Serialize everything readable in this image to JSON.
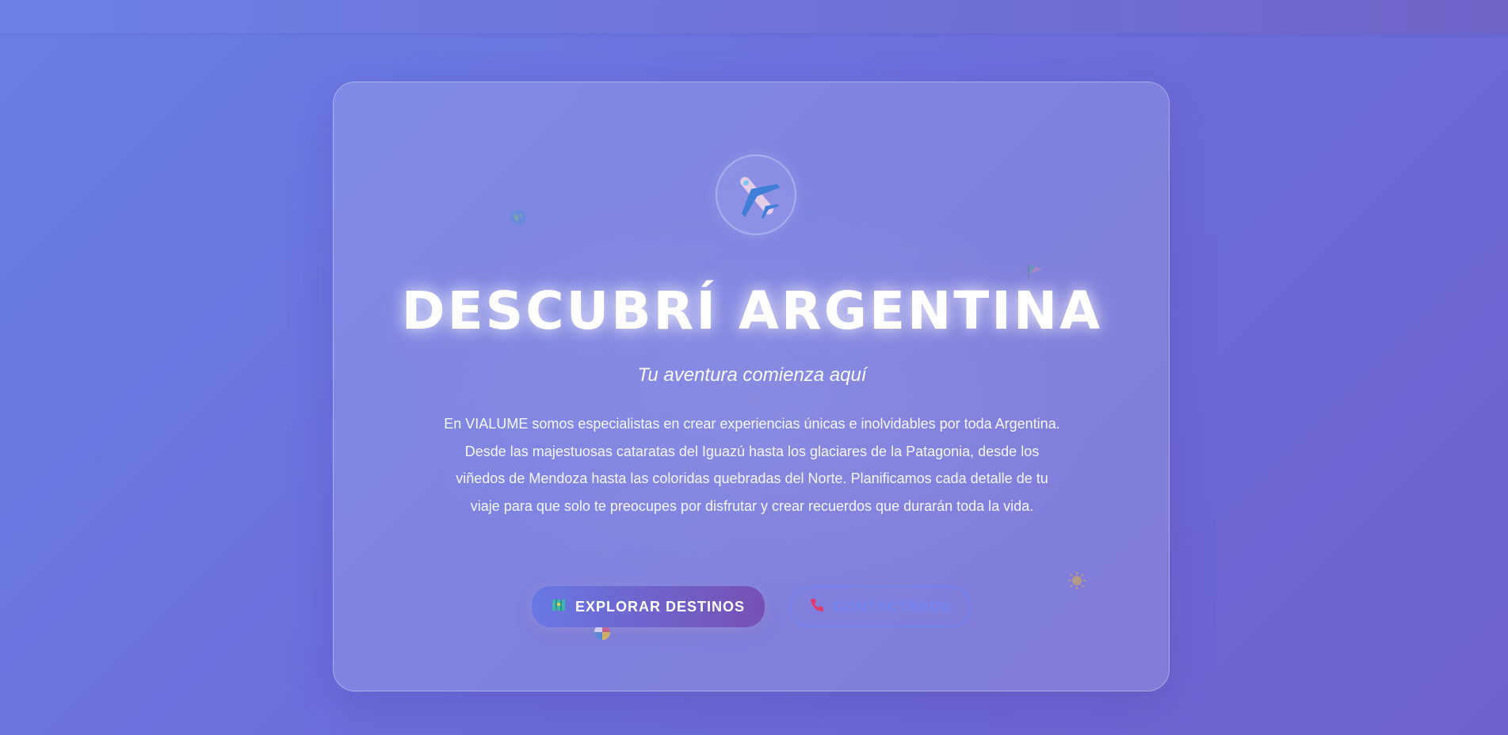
{
  "hero": {
    "title": "DESCUBRÍ ARGENTINA",
    "subtitle": "Tu aventura comienza aquí",
    "description": "En VIALUME somos especialistas en crear experiencias únicas e inolvidables por toda Argentina. Desde las majestuosas cataratas del Iguazú hasta los glaciares de la Patagonia, desde los viñedos de Mendoza hasta las coloridas quebradas del Norte. Planificamos cada detalle de tu viaje para que solo te preocupes por disfrutar y crear recuerdos que durarán toda la vida.",
    "hero_icon": "airplane-icon"
  },
  "buttons": {
    "explore_label": "EXPLORAR DESTINOS",
    "explore_icon": "map-icon",
    "contact_label": "CONTACTANOS",
    "contact_icon": "phone-icon"
  },
  "decorations": [
    "globe-icon",
    "flag-icon",
    "sun-icon",
    "beach-ball-icon"
  ],
  "colors": {
    "background_start": "#6a7fe6",
    "background_end": "#6f62cc",
    "primary_button_start": "#6878e4",
    "primary_button_end": "#7650b4",
    "secondary_button_outline": "#6e82f0"
  }
}
